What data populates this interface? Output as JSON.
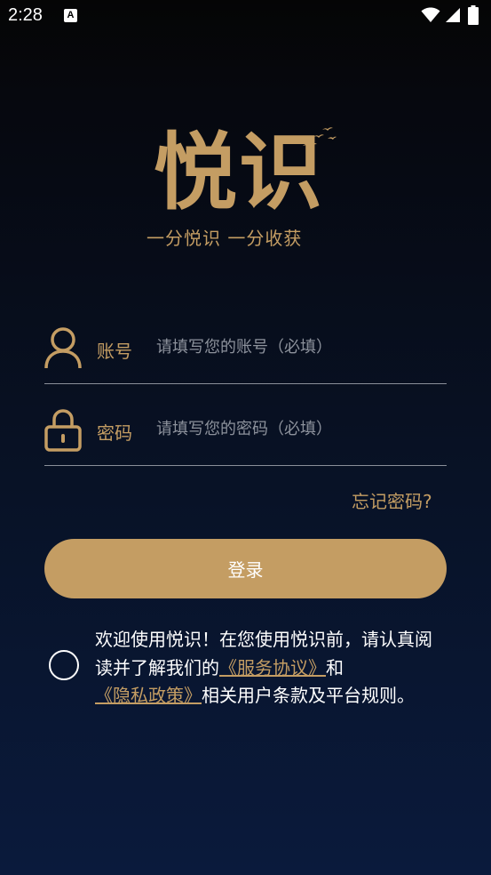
{
  "status_bar": {
    "time": "2:28",
    "notification_icon_glyph": "A",
    "icons": [
      "a-notification-icon",
      "wifi-icon",
      "signal-icon",
      "battery-icon"
    ]
  },
  "logo": {
    "title": "悦识",
    "slogan": "一分悦识 一分收获"
  },
  "form": {
    "account": {
      "label": "账号",
      "placeholder": "请填写您的账号（必填）",
      "value": "",
      "icon": "user-icon"
    },
    "password": {
      "label": "密码",
      "placeholder": "请填写您的密码（必填）",
      "value": "",
      "icon": "lock-icon"
    },
    "forgot_password": "忘记密码?",
    "login_button": "登录"
  },
  "agreement": {
    "checked": false,
    "text_before": "欢迎使用悦识！在您使用悦识前，请认真阅读并了解我们的",
    "service_link": "《服务协议》",
    "text_middle": "和",
    "privacy_link": "《隐私政策》",
    "text_after": "相关用户条款及平台规则。"
  },
  "colors": {
    "accent": "#c49d63",
    "background_top": "#050505",
    "background_bottom": "#0a1a3c",
    "placeholder": "#8d929c",
    "divider": "#8a8f99"
  }
}
